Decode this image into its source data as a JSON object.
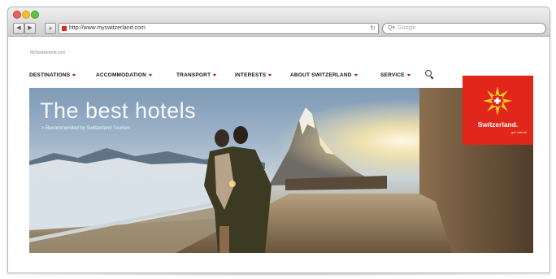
{
  "browser": {
    "url": "http://www.myswitzerland.com",
    "search_placeholder": "Google"
  },
  "site": {
    "small_header": "MySwitzerland.com",
    "menu": [
      {
        "label": "DESTINATIONS"
      },
      {
        "label": "ACCOMMODATION"
      },
      {
        "label": "TRANSPORT"
      },
      {
        "label": "INTERESTS"
      },
      {
        "label": "ABOUT SWITZERLAND"
      },
      {
        "label": "SERVICE"
      }
    ],
    "search_icon": "magnifier-icon"
  },
  "hero": {
    "title": "The best hotels",
    "subtitle": "> Recommended by Switzerland Tourism"
  },
  "logo": {
    "wordmark": "Switzerland.",
    "tagline": "get natural."
  },
  "colors": {
    "brand_red": "#e1261c",
    "caret_red": "#cc0000"
  }
}
